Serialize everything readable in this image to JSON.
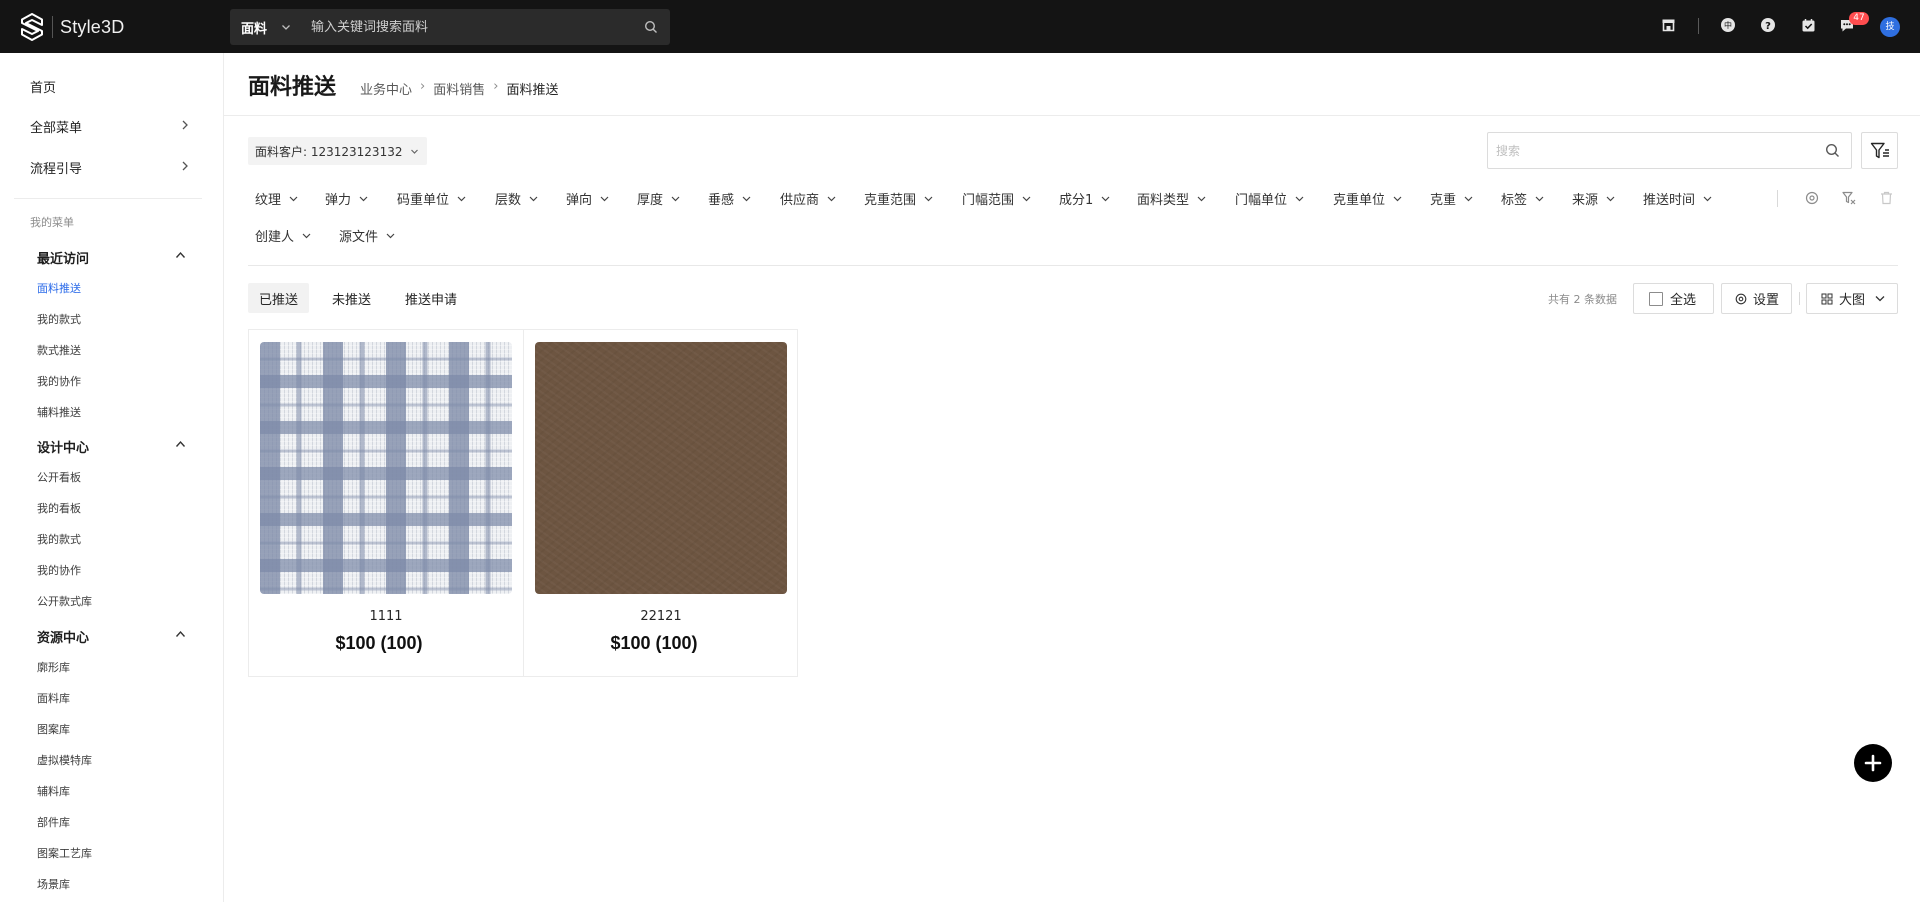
{
  "app": {
    "brand": "Style3D"
  },
  "topbar": {
    "search_category": "面料",
    "search_placeholder": "输入关键词搜索面料",
    "messages_badge": "47",
    "avatar_initial": "技"
  },
  "sidebar": {
    "home": "首页",
    "all_menu": "全部菜单",
    "process_guide": "流程引导",
    "my_menu_caption": "我的菜单",
    "groups": [
      {
        "title": "最近访问",
        "items": [
          "面料推送",
          "我的款式",
          "款式推送",
          "我的协作",
          "辅料推送"
        ]
      },
      {
        "title": "设计中心",
        "items": [
          "公开看板",
          "我的看板",
          "我的款式",
          "我的协作",
          "公开款式库"
        ]
      },
      {
        "title": "资源中心",
        "items": [
          "廓形库",
          "面料库",
          "图案库",
          "虚拟模特库",
          "辅料库",
          "部件库",
          "图案工艺库",
          "场景库"
        ]
      }
    ]
  },
  "page": {
    "title": "面料推送",
    "breadcrumb": [
      "业务中心",
      "面料销售",
      "面料推送"
    ],
    "customer_select": "面料客户: 123123123132",
    "search_placeholder": "搜索"
  },
  "filters": [
    "纹理",
    "弹力",
    "码重单位",
    "层数",
    "弹向",
    "厚度",
    "垂感",
    "供应商",
    "克重范围",
    "门幅范围",
    "成分1",
    "面料类型",
    "门幅单位",
    "克重单位",
    "克重",
    "标签",
    "来源",
    "推送时间",
    "创建人",
    "源文件"
  ],
  "tabs": [
    "已推送",
    "未推送",
    "推送申请"
  ],
  "toolbar": {
    "count_text": "共有 2 条数据",
    "select_all": "全选",
    "settings": "设置",
    "view_mode": "大图"
  },
  "cards": [
    {
      "name": "1111",
      "price": "$100 (100)"
    },
    {
      "name": "22121",
      "price": "$100 (100)"
    }
  ],
  "colors": {
    "accent": "#2a6ae9",
    "topbar": "#141414",
    "badge": "#ff4d4f",
    "avatar": "#2f6fe0"
  }
}
